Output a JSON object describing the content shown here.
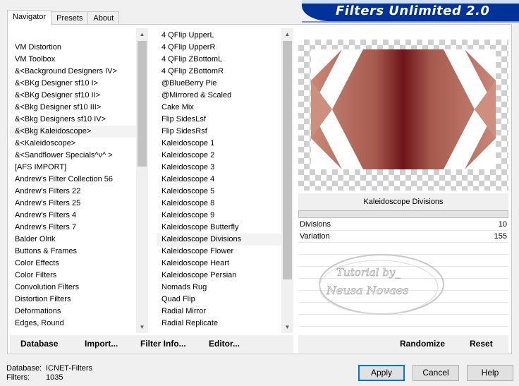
{
  "window": {
    "title": "Filters Unlimited 2.0"
  },
  "tabs": [
    {
      "label": "Navigator",
      "active": true
    },
    {
      "label": "Presets",
      "active": false
    },
    {
      "label": "About",
      "active": false
    }
  ],
  "categories": {
    "items": [
      "VM Distortion",
      "VM Toolbox",
      "&<Background Designers IV>",
      "&<BKg Designer sf10 I>",
      "&<BKg Designer sf10 II>",
      "&<Bkg Designer sf10 III>",
      "&<Bkg Designers sf10 IV>",
      "&<Bkg Kaleidoscope>",
      "&<Kaleidoscope>",
      "&<Sandflower Specials^v^ >",
      "[AFS IMPORT]",
      "Andrew's Filter Collection 56",
      "Andrew's Filters 22",
      "Andrew's Filters 25",
      "Andrew's Filters 4",
      "Andrew's Filters 7",
      "Balder Olrik",
      "Buttons & Frames",
      "Color Effects",
      "Color Filters",
      "Convolution Filters",
      "Distortion Filters",
      "Déformations",
      "Edges, Round"
    ],
    "selected": "&<Bkg Kaleidoscope>"
  },
  "filters": {
    "items": [
      "4 QFlip UpperL",
      "4 QFlip UpperR",
      "4 QFlip ZBottomL",
      "4 QFlip ZBottomR",
      "@BlueBerry Pie",
      "@Mirrored & Scaled",
      "Cake Mix",
      "Flip SidesLsf",
      "Flip SidesRsf",
      "Kaleidoscope 1",
      "Kaleidoscope 2",
      "Kaleidoscope 3",
      "Kaleidoscope 4",
      "Kaleidoscope 5",
      "Kaleidoscope 8",
      "Kaleidoscope 9",
      "Kaleidoscope Butterfly",
      "Kaleidoscope Divisions",
      "Kaleidoscope Flower",
      "Kaleidoscope Heart",
      "Kaleidoscope Persian",
      "Nomads Rug",
      "Quad Flip",
      "Radial Mirror",
      "Radial Replicate"
    ],
    "selected": "Kaleidoscope Divisions"
  },
  "params": {
    "title": "Kaleidoscope Divisions",
    "rows": [
      {
        "label": "Divisions",
        "value": "10"
      },
      {
        "label": "Variation",
        "value": "155"
      }
    ]
  },
  "watermark": {
    "line1": "Tutorial by_",
    "line2": "Neusa Novaes"
  },
  "toolbar": {
    "database": "Database",
    "import": "Import...",
    "filter_info": "Filter Info...",
    "editor": "Editor...",
    "randomize": "Randomize",
    "reset": "Reset"
  },
  "status": {
    "database_label": "Database:",
    "database_value": "ICNET-Filters",
    "filters_label": "Filters:",
    "filters_value": "1035"
  },
  "buttons": {
    "apply": "Apply",
    "cancel": "Cancel",
    "help": "Help"
  },
  "colors": {
    "banner": "#003399",
    "preview_dark": "#6e1418",
    "preview_light": "#c98776"
  }
}
